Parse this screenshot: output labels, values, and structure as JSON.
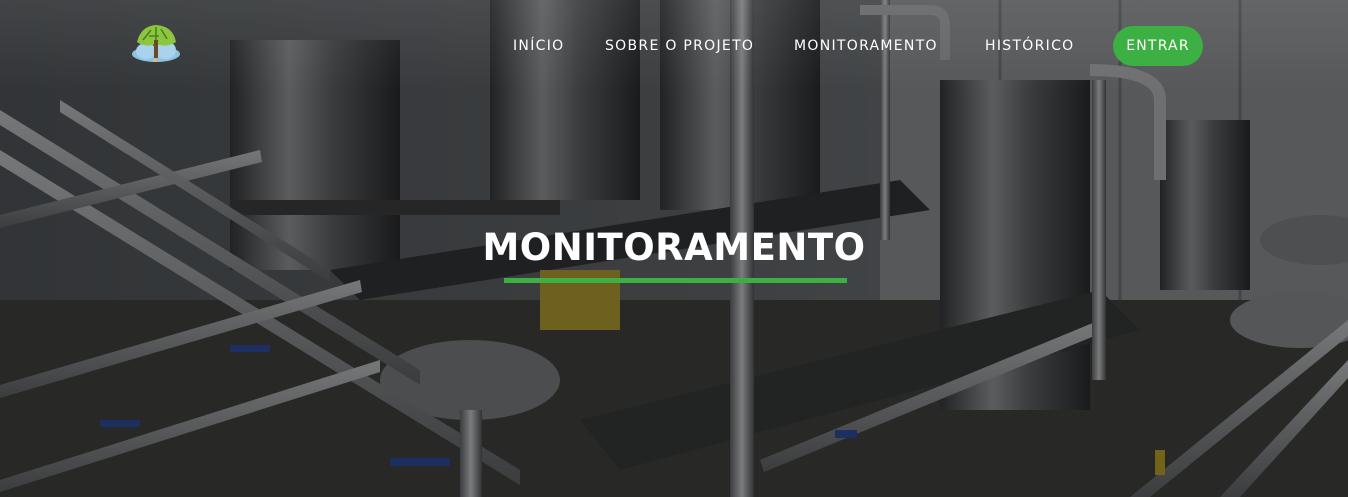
{
  "header": {
    "logo_icon": "tree-cloud-logo",
    "nav": [
      {
        "label": "INÍCIO"
      },
      {
        "label": "SOBRE O PROJETO"
      },
      {
        "label": "MONITORAMENTO"
      },
      {
        "label": "HISTÓRICO"
      }
    ],
    "login_label": "ENTRAR"
  },
  "hero": {
    "title": "MONITORAMENTO",
    "background": "industrial-plant-pipes-tanks-photo"
  },
  "colors": {
    "accent": "#3cb043",
    "text": "#ffffff"
  }
}
